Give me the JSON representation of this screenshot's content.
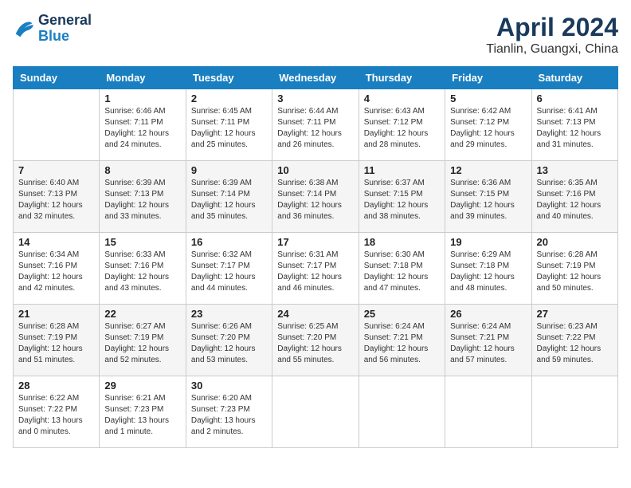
{
  "header": {
    "logo_line1": "General",
    "logo_line2": "Blue",
    "month": "April 2024",
    "location": "Tianlin, Guangxi, China"
  },
  "weekdays": [
    "Sunday",
    "Monday",
    "Tuesday",
    "Wednesday",
    "Thursday",
    "Friday",
    "Saturday"
  ],
  "weeks": [
    [
      {
        "day": "",
        "info": ""
      },
      {
        "day": "1",
        "info": "Sunrise: 6:46 AM\nSunset: 7:11 PM\nDaylight: 12 hours\nand 24 minutes."
      },
      {
        "day": "2",
        "info": "Sunrise: 6:45 AM\nSunset: 7:11 PM\nDaylight: 12 hours\nand 25 minutes."
      },
      {
        "day": "3",
        "info": "Sunrise: 6:44 AM\nSunset: 7:11 PM\nDaylight: 12 hours\nand 26 minutes."
      },
      {
        "day": "4",
        "info": "Sunrise: 6:43 AM\nSunset: 7:12 PM\nDaylight: 12 hours\nand 28 minutes."
      },
      {
        "day": "5",
        "info": "Sunrise: 6:42 AM\nSunset: 7:12 PM\nDaylight: 12 hours\nand 29 minutes."
      },
      {
        "day": "6",
        "info": "Sunrise: 6:41 AM\nSunset: 7:13 PM\nDaylight: 12 hours\nand 31 minutes."
      }
    ],
    [
      {
        "day": "7",
        "info": "Sunrise: 6:40 AM\nSunset: 7:13 PM\nDaylight: 12 hours\nand 32 minutes."
      },
      {
        "day": "8",
        "info": "Sunrise: 6:39 AM\nSunset: 7:13 PM\nDaylight: 12 hours\nand 33 minutes."
      },
      {
        "day": "9",
        "info": "Sunrise: 6:39 AM\nSunset: 7:14 PM\nDaylight: 12 hours\nand 35 minutes."
      },
      {
        "day": "10",
        "info": "Sunrise: 6:38 AM\nSunset: 7:14 PM\nDaylight: 12 hours\nand 36 minutes."
      },
      {
        "day": "11",
        "info": "Sunrise: 6:37 AM\nSunset: 7:15 PM\nDaylight: 12 hours\nand 38 minutes."
      },
      {
        "day": "12",
        "info": "Sunrise: 6:36 AM\nSunset: 7:15 PM\nDaylight: 12 hours\nand 39 minutes."
      },
      {
        "day": "13",
        "info": "Sunrise: 6:35 AM\nSunset: 7:16 PM\nDaylight: 12 hours\nand 40 minutes."
      }
    ],
    [
      {
        "day": "14",
        "info": "Sunrise: 6:34 AM\nSunset: 7:16 PM\nDaylight: 12 hours\nand 42 minutes."
      },
      {
        "day": "15",
        "info": "Sunrise: 6:33 AM\nSunset: 7:16 PM\nDaylight: 12 hours\nand 43 minutes."
      },
      {
        "day": "16",
        "info": "Sunrise: 6:32 AM\nSunset: 7:17 PM\nDaylight: 12 hours\nand 44 minutes."
      },
      {
        "day": "17",
        "info": "Sunrise: 6:31 AM\nSunset: 7:17 PM\nDaylight: 12 hours\nand 46 minutes."
      },
      {
        "day": "18",
        "info": "Sunrise: 6:30 AM\nSunset: 7:18 PM\nDaylight: 12 hours\nand 47 minutes."
      },
      {
        "day": "19",
        "info": "Sunrise: 6:29 AM\nSunset: 7:18 PM\nDaylight: 12 hours\nand 48 minutes."
      },
      {
        "day": "20",
        "info": "Sunrise: 6:28 AM\nSunset: 7:19 PM\nDaylight: 12 hours\nand 50 minutes."
      }
    ],
    [
      {
        "day": "21",
        "info": "Sunrise: 6:28 AM\nSunset: 7:19 PM\nDaylight: 12 hours\nand 51 minutes."
      },
      {
        "day": "22",
        "info": "Sunrise: 6:27 AM\nSunset: 7:19 PM\nDaylight: 12 hours\nand 52 minutes."
      },
      {
        "day": "23",
        "info": "Sunrise: 6:26 AM\nSunset: 7:20 PM\nDaylight: 12 hours\nand 53 minutes."
      },
      {
        "day": "24",
        "info": "Sunrise: 6:25 AM\nSunset: 7:20 PM\nDaylight: 12 hours\nand 55 minutes."
      },
      {
        "day": "25",
        "info": "Sunrise: 6:24 AM\nSunset: 7:21 PM\nDaylight: 12 hours\nand 56 minutes."
      },
      {
        "day": "26",
        "info": "Sunrise: 6:24 AM\nSunset: 7:21 PM\nDaylight: 12 hours\nand 57 minutes."
      },
      {
        "day": "27",
        "info": "Sunrise: 6:23 AM\nSunset: 7:22 PM\nDaylight: 12 hours\nand 59 minutes."
      }
    ],
    [
      {
        "day": "28",
        "info": "Sunrise: 6:22 AM\nSunset: 7:22 PM\nDaylight: 13 hours\nand 0 minutes."
      },
      {
        "day": "29",
        "info": "Sunrise: 6:21 AM\nSunset: 7:23 PM\nDaylight: 13 hours\nand 1 minute."
      },
      {
        "day": "30",
        "info": "Sunrise: 6:20 AM\nSunset: 7:23 PM\nDaylight: 13 hours\nand 2 minutes."
      },
      {
        "day": "",
        "info": ""
      },
      {
        "day": "",
        "info": ""
      },
      {
        "day": "",
        "info": ""
      },
      {
        "day": "",
        "info": ""
      }
    ]
  ]
}
